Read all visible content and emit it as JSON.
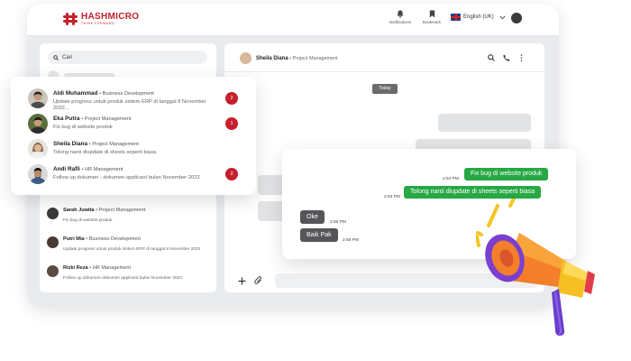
{
  "app": {
    "logo": {
      "name": "HASHMICRO",
      "tagline": "THINK FORWARD"
    },
    "topbar": {
      "notifications_label": "Notifications",
      "bookmark_label": "Bookmark",
      "language": "English (UK)"
    }
  },
  "sidebar": {
    "search_placeholder": "Cari",
    "chats": [
      {
        "name": "Sarah Juwita",
        "dept": "Project Management",
        "message": "Fix bug di website produk"
      },
      {
        "name": "Putri Mia",
        "dept": "Business Development",
        "message": "Update progress untuk produk sistem ERP di tanggal 8 November 2022"
      },
      {
        "name": "Rizki Reza",
        "dept": "HR Management",
        "message": "Follow up dokumen-dokumen applicant bulan November 2022"
      }
    ]
  },
  "chat": {
    "contact_name": "Sheila Diana",
    "contact_dept": "Project Management",
    "date_divider": "Today"
  },
  "overlay_list": [
    {
      "name": "Aldi Muhammad",
      "dept": "Business Development",
      "message": "Update progress untuk produk sistem ERP di tanggal 8 November 2022...",
      "unread": "2"
    },
    {
      "name": "Eka Putra",
      "dept": "Project Management",
      "message": "Fix bug di website produk",
      "unread": "1"
    },
    {
      "name": "Sheila Diana",
      "dept": "Project Management",
      "message": "Tolong nanti diupdate di sheets seperti biasa",
      "unread": ""
    },
    {
      "name": "Andi Rafli",
      "dept": "HR Management",
      "message": "Follow up dokumen - dokumen applicant bulan November 2022",
      "unread": "2"
    }
  ],
  "conversation": [
    {
      "direction": "out",
      "text": "Fix bug di website produk",
      "time": "2:54 PM"
    },
    {
      "direction": "out",
      "text": "Tolong nanti diupdate di sheets seperti biasa",
      "time": "2:54 PM"
    },
    {
      "direction": "in",
      "text": "Oke",
      "time": "2:56 PM"
    },
    {
      "direction": "in",
      "text": "Baik Pak",
      "time": "2:56 PM"
    }
  ],
  "colors": {
    "brand": "#c5202d",
    "outgoing_bubble": "#27a844",
    "incoming_bubble": "#555659"
  },
  "icons": [
    "notification-bell-icon",
    "bookmark-icon",
    "uk-flag-icon",
    "chevron-down-icon",
    "search-icon",
    "phone-icon",
    "more-vertical-icon",
    "plus-icon",
    "paperclip-icon",
    "megaphone-icon"
  ]
}
